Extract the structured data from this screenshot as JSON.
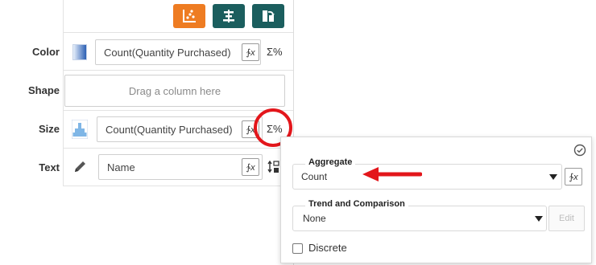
{
  "toolbar": {
    "buttons": [
      {
        "name": "scatter-chart-icon",
        "color": "#ee7c22"
      },
      {
        "name": "align-icon",
        "color": "#1b5e5e"
      },
      {
        "name": "rotate-icon",
        "color": "#1b5e5e"
      }
    ]
  },
  "rows": {
    "color": {
      "label": "Color",
      "value": "Count(Quantity Purchased)"
    },
    "shape": {
      "label": "Shape",
      "placeholder": "Drag a column here"
    },
    "size": {
      "label": "Size",
      "value": "Count(Quantity Purchased)"
    },
    "text": {
      "label": "Text",
      "value": "Name"
    }
  },
  "aggregate_symbol": "Σ%",
  "popup": {
    "aggregate": {
      "label": "Aggregate",
      "value": "Count"
    },
    "trend": {
      "label": "Trend and Comparison",
      "value": "None",
      "edit_label": "Edit"
    },
    "discrete": {
      "label": "Discrete",
      "checked": false
    }
  },
  "colors": {
    "highlight": "#e3161b",
    "arrow": "#e3161b",
    "accent_orange": "#ee7c22",
    "accent_teal": "#1b5e5e"
  }
}
